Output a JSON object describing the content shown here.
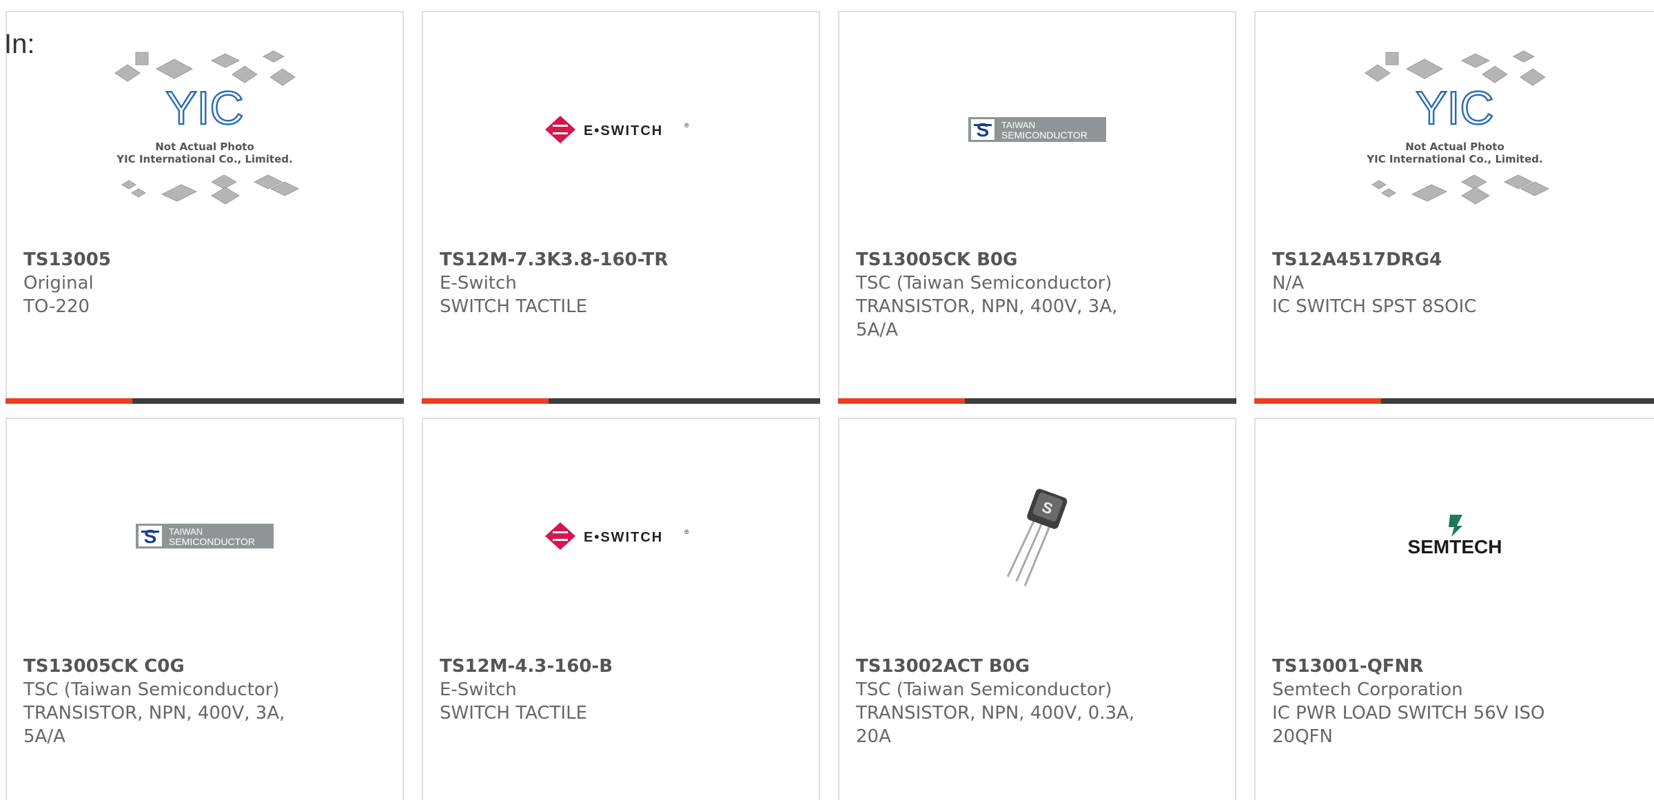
{
  "page": {
    "label": "In:"
  },
  "colors": {
    "accent": "#e8401c",
    "bar": "#3d3d3d",
    "border": "#e0e0e0",
    "eswitch_red": "#d6164e",
    "taiwan_blue": "#1b3f8f",
    "taiwan_gray": "#8f9596",
    "semtech_green": "#1e7a57",
    "yic_blue": "#2b6cb5"
  },
  "logos": {
    "yic": {
      "name": "yic-placeholder-logo",
      "mark": "YIC",
      "line1": "Not Actual Photo",
      "line2": "YIC International Co., Limited."
    },
    "eswitch": {
      "name": "e-switch-logo",
      "text": "E•SWITCH",
      "reg": "®"
    },
    "taiwan": {
      "name": "taiwan-semiconductor-logo",
      "line1": "TAIWAN",
      "line2": "SEMICONDUCTOR"
    },
    "semtech": {
      "name": "semtech-logo",
      "text": "SEMTECH"
    }
  },
  "products": [
    {
      "part_number": "TS13005",
      "manufacturer": "Original",
      "description": "TO-220",
      "image": "yic-placeholder"
    },
    {
      "part_number": "TS12M-7.3K3.8-160-TR",
      "manufacturer": "E-Switch",
      "description": "SWITCH TACTILE",
      "image": "e-switch-logo"
    },
    {
      "part_number": "TS13005CK B0G",
      "manufacturer": "TSC (Taiwan Semiconductor)",
      "description": "TRANSISTOR, NPN, 400V, 3A, 5A/A",
      "image": "taiwan-semiconductor-logo"
    },
    {
      "part_number": "TS12A4517DRG4",
      "manufacturer": "N/A",
      "description": "IC SWITCH SPST 8SOIC",
      "image": "yic-placeholder"
    },
    {
      "part_number": "TS13005CK C0G",
      "manufacturer": "TSC (Taiwan Semiconductor)",
      "description": "TRANSISTOR, NPN, 400V, 3A, 5A/A",
      "image": "taiwan-semiconductor-logo"
    },
    {
      "part_number": "TS12M-4.3-160-B",
      "manufacturer": "E-Switch",
      "description": "SWITCH TACTILE",
      "image": "e-switch-logo"
    },
    {
      "part_number": "TS13002ACT B0G",
      "manufacturer": "TSC (Taiwan Semiconductor)",
      "description": "TRANSISTOR, NPN, 400V, 0.3A, 20A",
      "image": "to92-transistor-photo"
    },
    {
      "part_number": "TS13001-QFNR",
      "manufacturer": "Semtech Corporation",
      "description": "IC PWR LOAD SWITCH 56V ISO 20QFN",
      "image": "semtech-logo"
    }
  ]
}
